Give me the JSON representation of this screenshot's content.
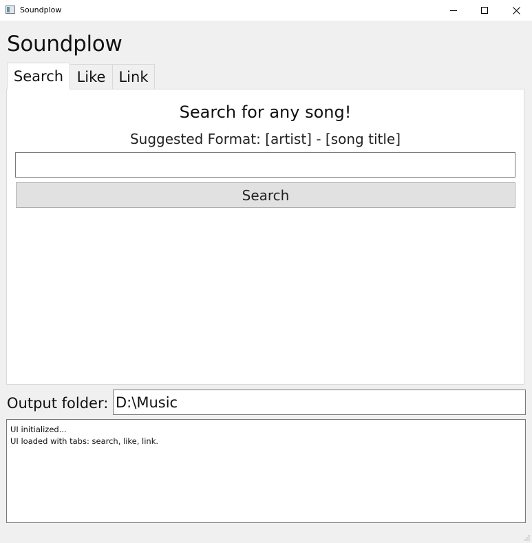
{
  "window": {
    "title": "Soundplow",
    "controls": {
      "minimize_icon": "minimize-icon",
      "maximize_icon": "maximize-icon",
      "close_icon": "close-icon"
    }
  },
  "app": {
    "heading": "Soundplow"
  },
  "tabs": [
    {
      "label": "Search",
      "active": true
    },
    {
      "label": "Like",
      "active": false
    },
    {
      "label": "Link",
      "active": false
    }
  ],
  "search_panel": {
    "heading": "Search for any song!",
    "format_hint": "Suggested Format: [artist] - [song title]",
    "query_value": "",
    "button_label": "Search"
  },
  "output": {
    "label": "Output folder:",
    "path": "D:\\Music"
  },
  "log": {
    "lines": [
      "UI initialized...",
      "UI loaded with tabs: search, like, link."
    ]
  },
  "colors": {
    "window_background": "#f0f0f0",
    "panel_background": "#ffffff",
    "button_background": "#e1e1e1",
    "border": "#7a7a7a"
  }
}
